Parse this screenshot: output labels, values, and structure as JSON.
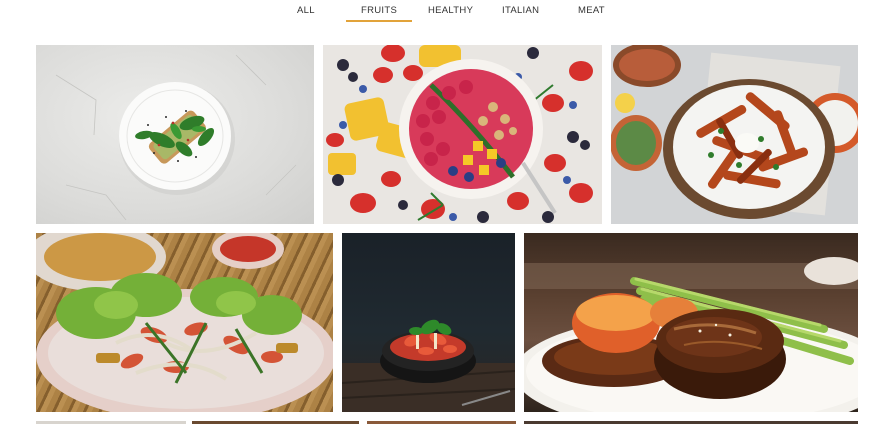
{
  "filters": {
    "items": [
      {
        "label": "ALL",
        "active": false
      },
      {
        "label": "FRUITS",
        "active": true
      },
      {
        "label": "HEALTHY",
        "active": false
      },
      {
        "label": "ITALIAN",
        "active": false
      },
      {
        "label": "MEAT",
        "active": false
      }
    ]
  },
  "colors": {
    "accent": "#e2a33a",
    "text": "#333333",
    "background": "#ffffff"
  },
  "gallery": {
    "tiles": [
      {
        "subject": "avocado-toast-plate"
      },
      {
        "subject": "smoothie-bowl-with-fruits"
      },
      {
        "subject": "sweet-potato-fries-platter"
      },
      {
        "subject": "seafood-salad"
      },
      {
        "subject": "dark-bowl-salad"
      },
      {
        "subject": "steak-with-asparagus"
      },
      {
        "subject": "partial-tile"
      },
      {
        "subject": "partial-tile"
      },
      {
        "subject": "partial-tile"
      },
      {
        "subject": "partial-tile"
      }
    ]
  }
}
